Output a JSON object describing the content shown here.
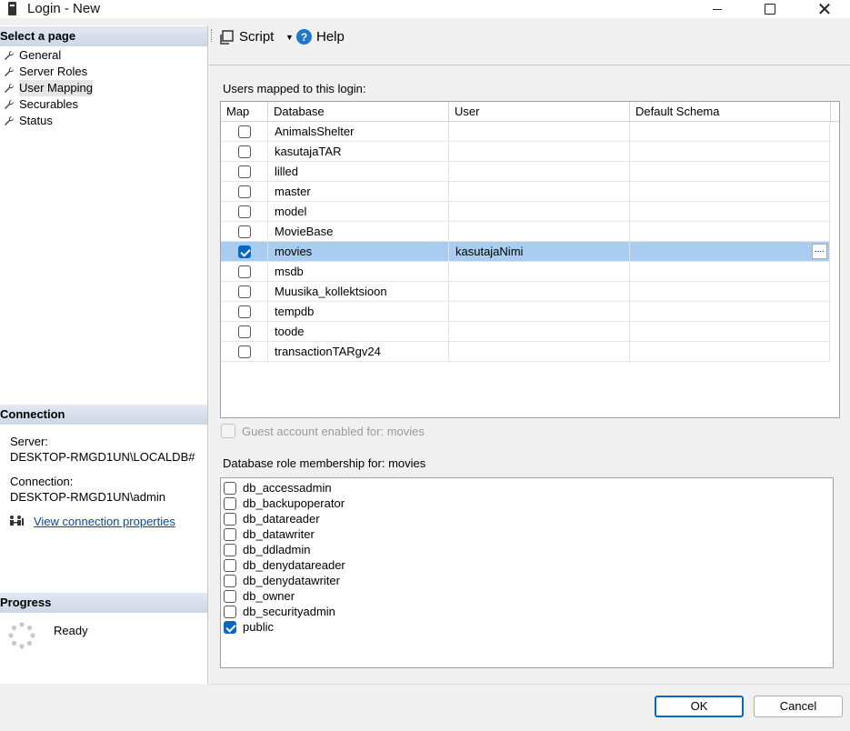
{
  "window": {
    "title": "Login - New"
  },
  "left_panel": {
    "select_page_header": "Select a page",
    "pages": [
      {
        "label": "General"
      },
      {
        "label": "Server Roles"
      },
      {
        "label": "User Mapping"
      },
      {
        "label": "Securables"
      },
      {
        "label": "Status"
      }
    ],
    "connection_header": "Connection",
    "server_label": "Server:",
    "server_value": "DESKTOP-RMGD1UN\\LOCALDB#",
    "connection_label": "Connection:",
    "connection_value": "DESKTOP-RMGD1UN\\admin",
    "view_connection_link": "View connection properties",
    "progress_header": "Progress",
    "progress_status": "Ready"
  },
  "toolbar": {
    "script_label": "Script",
    "help_label": "Help"
  },
  "users_mapped": {
    "label": "Users mapped to this login:",
    "columns": [
      "Map",
      "Database",
      "User",
      "Default Schema"
    ],
    "rows": [
      {
        "database": "AnimalsShelter",
        "user": "",
        "schema": "",
        "mapped": false
      },
      {
        "database": "kasutajaTAR",
        "user": "",
        "schema": "",
        "mapped": false
      },
      {
        "database": "lilled",
        "user": "",
        "schema": "",
        "mapped": false
      },
      {
        "database": "master",
        "user": "",
        "schema": "",
        "mapped": false
      },
      {
        "database": "model",
        "user": "",
        "schema": "",
        "mapped": false
      },
      {
        "database": "MovieBase",
        "user": "",
        "schema": "",
        "mapped": false
      },
      {
        "database": "movies",
        "user": "kasutajaNimi",
        "schema": "",
        "mapped": true
      },
      {
        "database": "msdb",
        "user": "",
        "schema": "",
        "mapped": false
      },
      {
        "database": "Muusika_kollektsioon",
        "user": "",
        "schema": "",
        "mapped": false
      },
      {
        "database": "tempdb",
        "user": "",
        "schema": "",
        "mapped": false
      },
      {
        "database": "toode",
        "user": "",
        "schema": "",
        "mapped": false
      },
      {
        "database": "transactionTARgv24",
        "user": "",
        "schema": "",
        "mapped": false
      }
    ],
    "ellipsis_label": "...."
  },
  "guest_account": {
    "label": "Guest account enabled for: movies",
    "checked": false,
    "enabled": false
  },
  "role_membership": {
    "label": "Database role membership for: movies",
    "roles": [
      {
        "label": "db_accessadmin",
        "checked": false
      },
      {
        "label": "db_backupoperator",
        "checked": false
      },
      {
        "label": "db_datareader",
        "checked": false
      },
      {
        "label": "db_datawriter",
        "checked": false
      },
      {
        "label": "db_ddladmin",
        "checked": false
      },
      {
        "label": "db_denydatareader",
        "checked": false
      },
      {
        "label": "db_denydatawriter",
        "checked": false
      },
      {
        "label": "db_owner",
        "checked": false
      },
      {
        "label": "db_securityadmin",
        "checked": false
      },
      {
        "label": "public",
        "checked": true
      }
    ]
  },
  "buttons": {
    "ok": "OK",
    "cancel": "Cancel"
  },
  "colors": {
    "selection": "#a8cdf0",
    "accent": "#0b67c4",
    "link": "#0645ad"
  }
}
